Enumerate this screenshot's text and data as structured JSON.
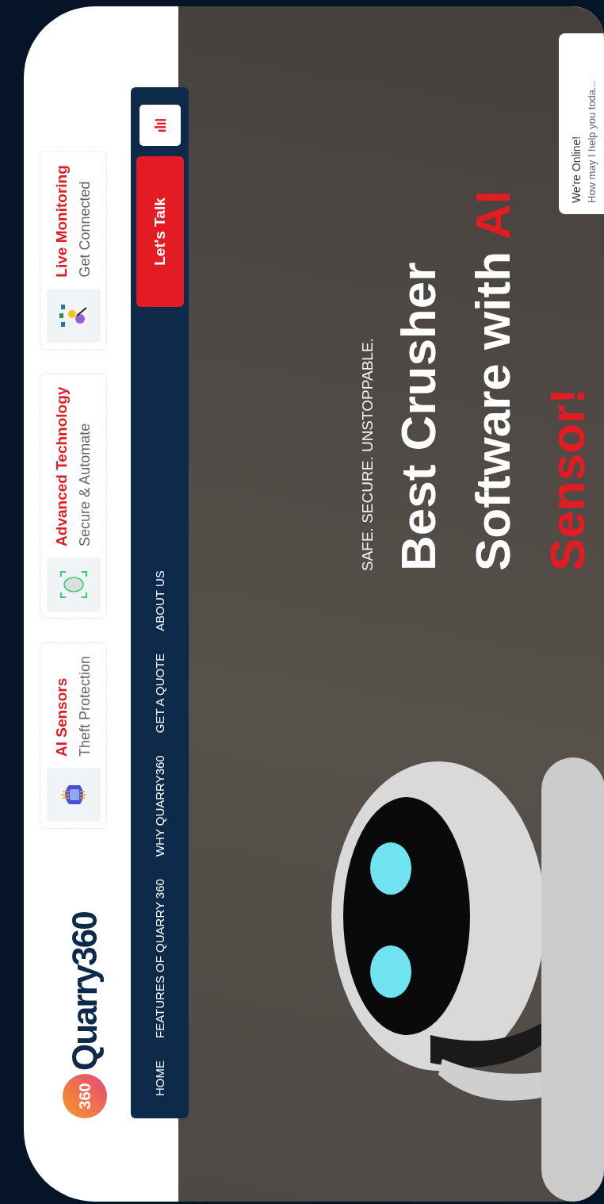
{
  "logo": {
    "badge": "360",
    "name": "Quarry360"
  },
  "features": [
    {
      "kind": "chip",
      "title": "AI Sensors",
      "subtitle": "Theft Protection"
    },
    {
      "kind": "face-scan",
      "title": "Advanced Technology",
      "subtitle": "Secure & Automate"
    },
    {
      "kind": "network",
      "title": "Live Monitoring",
      "subtitle": "Get Connected"
    }
  ],
  "nav": {
    "items": [
      "HOME",
      "FEATURES OF QUARRY 360",
      "WHY QUARRY360",
      "GET A QUOTE",
      "ABOUT US"
    ],
    "cta": "Let's Talk"
  },
  "hero": {
    "tagline": "SAFE. SECURE. UNSTOPPABLE.",
    "headline_lines": [
      {
        "parts": [
          {
            "text": "Best Crusher",
            "accent": false
          }
        ]
      },
      {
        "parts": [
          {
            "text": "Software with ",
            "accent": false
          },
          {
            "text": "AI",
            "accent": true
          }
        ]
      },
      {
        "parts": [
          {
            "text": "Sensor!",
            "accent": true
          }
        ]
      }
    ]
  },
  "chat": {
    "title": "We're Online!",
    "message": "How may I help you toda..."
  }
}
